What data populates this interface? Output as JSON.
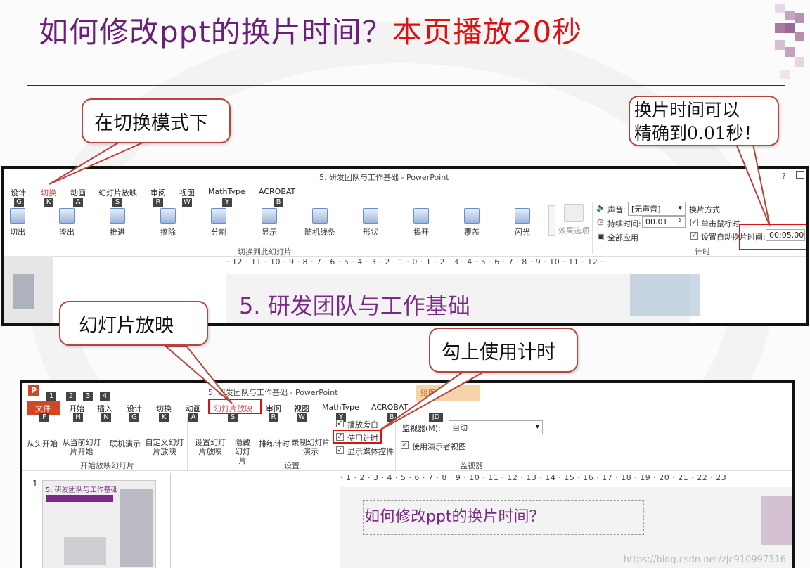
{
  "title": {
    "part1": "如何修改ppt的换片时间？",
    "part2": "本页播放20秒"
  },
  "callouts": {
    "switch_mode": "在切换模式下",
    "precision_line1": "换片时间可以",
    "precision_line2": "精确到0.01秒！",
    "slideshow": "幻灯片放映",
    "check_timing": "勾上使用计时"
  },
  "win1": {
    "title": "5. 研发团队与工作基础 - PowerPoint",
    "help": "?",
    "tabs": [
      "设计",
      "切换",
      "动画",
      "幻灯片放映",
      "审阅",
      "视图",
      "MathType",
      "ACROBAT"
    ],
    "keys": [
      "G",
      "K",
      "A",
      "S",
      "R",
      "W",
      "Y",
      "B"
    ],
    "effects": [
      "切出",
      "淡出",
      "推进",
      "擦除",
      "分割",
      "显示",
      "随机线条",
      "形状",
      "揭开",
      "覆盖",
      "闪光"
    ],
    "effect_options": "效果选项",
    "group_label": "切换到此幻灯片",
    "sound_label": "声音:",
    "sound_value": "[无声音]",
    "duration_label": "持续时间:",
    "duration_value": "00.01",
    "apply_all": "全部应用",
    "advance_label": "换片方式",
    "on_click": "单击鼠标时",
    "auto_after": "设置自动换片时间:",
    "auto_value": "00:05.00",
    "timing_group": "计时",
    "ruler": "· 12 · 11 · 10 · 9 · 8 · 7 · 6 · 5 · 4 · 3 · 2 · 1 · 0 · 1 · 2 · 3 · 4 · 5 · 6 · 7 · 8 · 9 · 10 · 11 · 12 ·",
    "slide_heading": "5. 研发团队与工作基础"
  },
  "win2": {
    "title": "5. 研发团队与工作基础 - PowerPoint",
    "drawing_tools": "绘图",
    "tabs": [
      "文件",
      "开始",
      "插入",
      "设计",
      "切换",
      "动画",
      "幻灯片放映",
      "审阅",
      "视图",
      "MathType",
      "ACROBAT"
    ],
    "qat_keys": [
      "1",
      "2",
      "3",
      "4"
    ],
    "keys": [
      "F",
      "H",
      "N",
      "G",
      "K",
      "A",
      "S",
      "R",
      "W",
      "Y",
      "B",
      "JD"
    ],
    "start_items": [
      "从头开始",
      "从当前幻灯片开始",
      "联机演示",
      "自定义幻灯片放映"
    ],
    "start_group": "开始放映幻灯片",
    "setup_items": [
      "设置幻灯片放映",
      "隐藏幻灯片",
      "排练计时",
      "录制幻灯片演示"
    ],
    "play_narration": "播放旁白",
    "use_timings": "使用计时",
    "show_media": "显示媒体控件",
    "setup_group": "设置",
    "monitor_label": "监视器(M):",
    "monitor_value": "自动",
    "presenter_view": "使用演示者视图",
    "monitor_group": "监视器",
    "ruler": "· 1 · 2 · 3 · 4 · 5 · 6 · 7 · 8 · 9 · 10 · 11 · 12 · 13 · 14 · 15 · 16 · 17 · 18 · 19 · 20 · 21 · 22 · 23",
    "thumb_number": "1",
    "thumb_title": "5. 研发团队与工作基础",
    "slide_title": "如何修改ppt的换片时间？",
    "watermark": "https://blog.csdn.net/zjc910997316"
  },
  "colors": {
    "title_purple": "#6a1f7a",
    "title_red": "#e01010",
    "callout_border": "#b8443c",
    "highlight_red": "#e01010"
  }
}
